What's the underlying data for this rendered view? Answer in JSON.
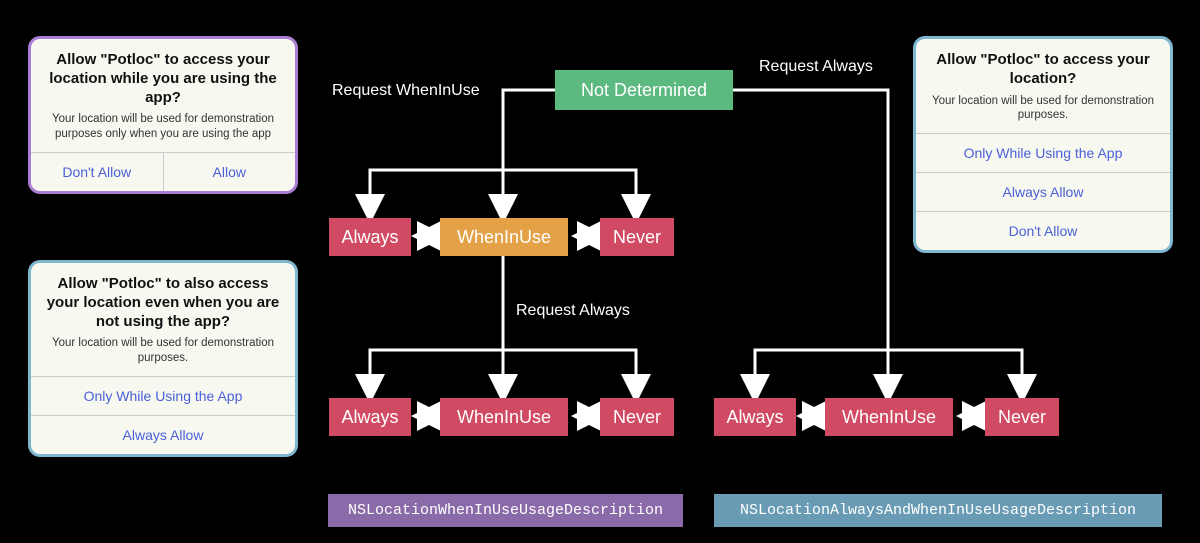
{
  "dialogs": {
    "whenInUse": {
      "title": "Allow \"Potloc\" to access your location while you are using the app?",
      "subtitle": "Your location will be used for demonstration purposes only when you are using the app",
      "buttons": {
        "deny": "Don't Allow",
        "allow": "Allow"
      }
    },
    "upgrade": {
      "title": "Allow \"Potloc\" to also access your location even when you are not using the app?",
      "subtitle": "Your location will be used for demonstration purposes.",
      "buttons": {
        "onlyInUse": "Only While Using the App",
        "always": "Always Allow"
      }
    },
    "always": {
      "title": "Allow \"Potloc\" to access your location?",
      "subtitle": "Your location will be used for demonstration purposes.",
      "buttons": {
        "onlyInUse": "Only While Using the App",
        "always": "Always Allow",
        "deny": "Don't Allow"
      }
    }
  },
  "nodes": {
    "notDetermined": "Not Determined",
    "always": "Always",
    "whenInUse": "WhenInUse",
    "never": "Never"
  },
  "labels": {
    "requestWhenInUse": "Request WhenInUse",
    "requestAlways1": "Request Always",
    "requestAlways2": "Request Always"
  },
  "plist": {
    "whenInUse": "NSLocationWhenInUseUsageDescription",
    "always": "NSLocationAlwaysAndWhenInUseUsageDescription"
  }
}
